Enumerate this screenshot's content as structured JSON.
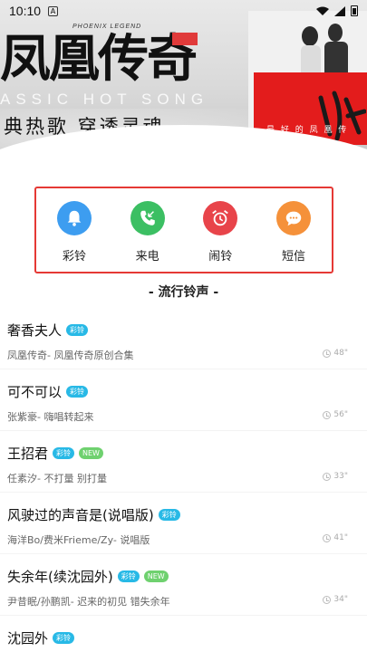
{
  "status_bar": {
    "time": "10:10",
    "notify_glyph": "A"
  },
  "banner": {
    "calligraphy": "凤凰传奇",
    "phoenix_en": "PHOENIX LEGEND",
    "sub_en": "ASSIC HOT SONG",
    "slogan": "典热歌 穿透灵魂",
    "album_text": "最 好 的 凤 凰 传"
  },
  "categories": [
    {
      "label": "彩铃",
      "icon": "bell-icon",
      "color": "#3d9df0"
    },
    {
      "label": "来电",
      "icon": "phone-incoming-icon",
      "color": "#3cbf63"
    },
    {
      "label": "闹铃",
      "icon": "alarm-clock-icon",
      "color": "#e8444a"
    },
    {
      "label": "短信",
      "icon": "message-icon",
      "color": "#f5913a"
    }
  ],
  "section_title": "- 流行铃声 -",
  "songs": [
    {
      "title": "奢香夫人",
      "badges": [
        "彩铃"
      ],
      "subtitle": "凤凰传奇-  凤凰传奇原创合集",
      "duration": "48\""
    },
    {
      "title": "可不可以",
      "badges": [
        "彩铃"
      ],
      "subtitle": "张紫豪-  嗨唱转起来",
      "duration": "56\""
    },
    {
      "title": "王招君",
      "badges": [
        "彩铃",
        "NEW"
      ],
      "subtitle": "任素汐-  不打量 别打量",
      "duration": "33\""
    },
    {
      "title": "风驶过的声音是(说唱版)",
      "badges": [
        "彩铃"
      ],
      "subtitle": "海洋Bo/费米Frieme/Zy-  说唱版",
      "duration": "41\""
    },
    {
      "title": "失余年(续沈园外)",
      "badges": [
        "彩铃",
        "NEW"
      ],
      "subtitle": "尹昔眠/孙鹏凯-  迟来的初见 错失余年",
      "duration": "34\""
    },
    {
      "title": "沈园外",
      "badges": [
        "彩铃"
      ],
      "subtitle": "",
      "duration": ""
    }
  ]
}
